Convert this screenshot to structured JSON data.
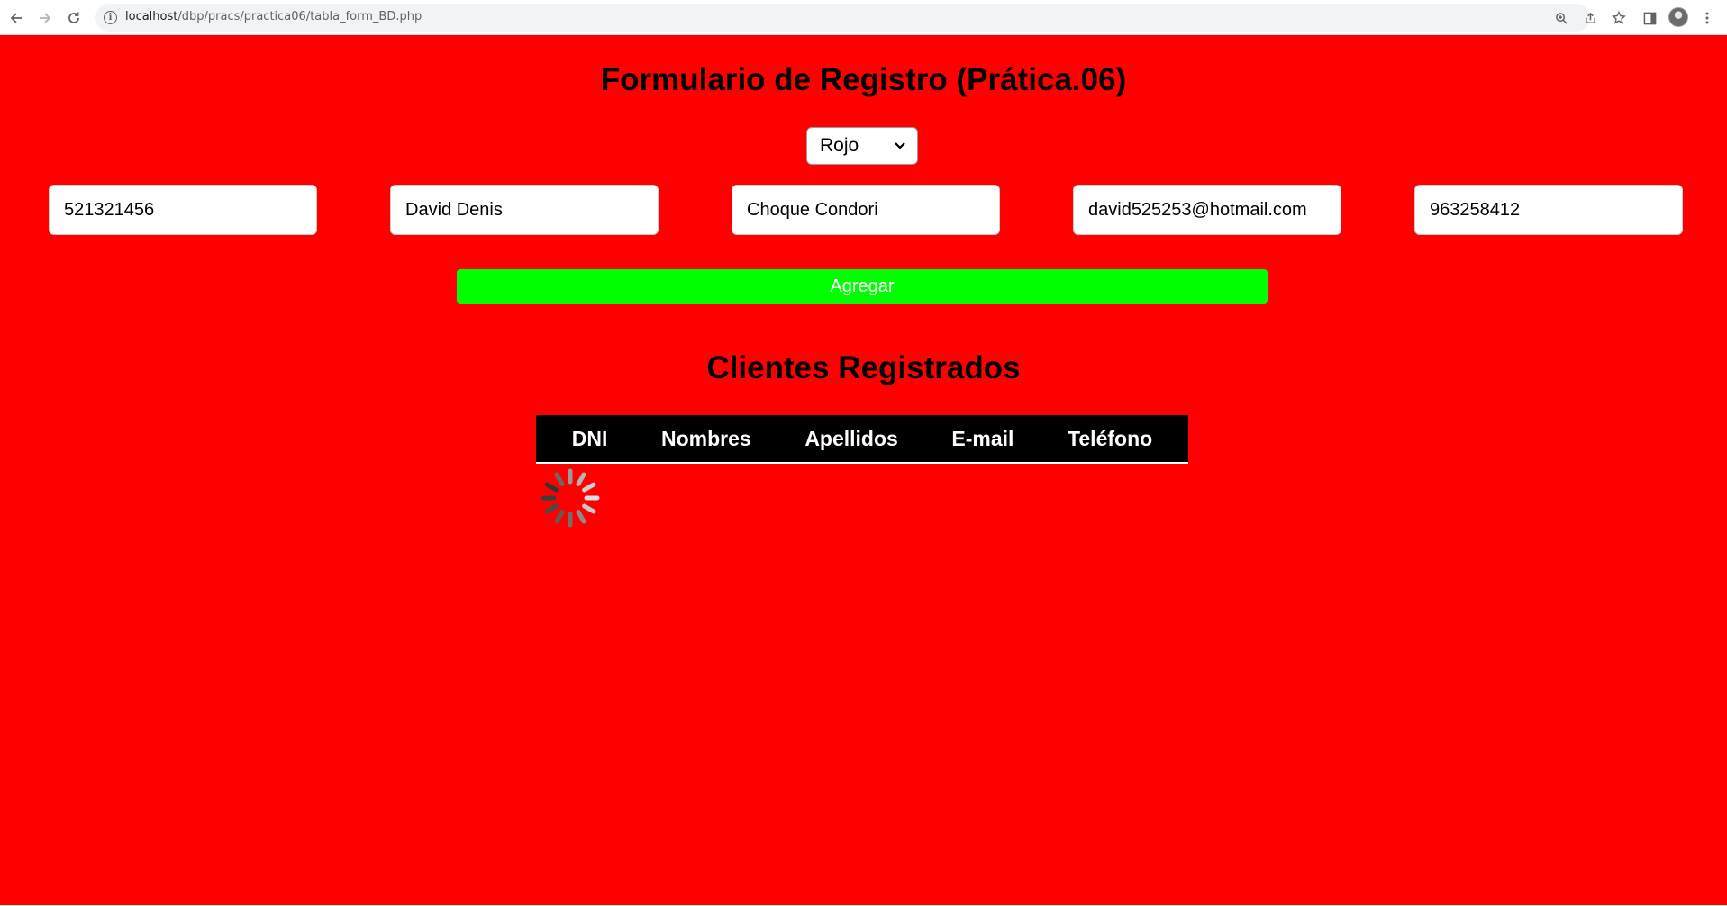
{
  "browser": {
    "url_host": "localhost",
    "url_path": "/dbp/pracs/practica06/tabla_form_BD.php"
  },
  "form": {
    "title": "Formulario de Registro (Prática.06)",
    "color_select": {
      "selected": "Rojo"
    },
    "fields": [
      {
        "name": "dni",
        "value": "521321456"
      },
      {
        "name": "nombres",
        "value": "David Denis"
      },
      {
        "name": "apellidos",
        "value": "Choque Condori"
      },
      {
        "name": "email",
        "value": "david525253@hotmail.com"
      },
      {
        "name": "telefono",
        "value": "963258412"
      }
    ],
    "submit_label": "Agregar"
  },
  "table": {
    "title": "Clientes Registrados",
    "headers": [
      "DNI",
      "Nombres",
      "Apellidos",
      "E-mail",
      "Teléfono"
    ]
  },
  "colors": {
    "page_background": "#ff0000",
    "button_background": "#00ff00",
    "table_header_background": "#000000"
  },
  "icons": {
    "back": "arrow-left-icon",
    "forward": "arrow-right-icon",
    "reload": "reload-icon",
    "site_info": "info-icon",
    "zoom": "zoom-icon",
    "share": "share-icon",
    "bookmark": "star-icon",
    "side_panel": "side-panel-icon",
    "profile": "avatar",
    "menu": "kebab-menu-icon",
    "loading": "spinner-icon"
  }
}
